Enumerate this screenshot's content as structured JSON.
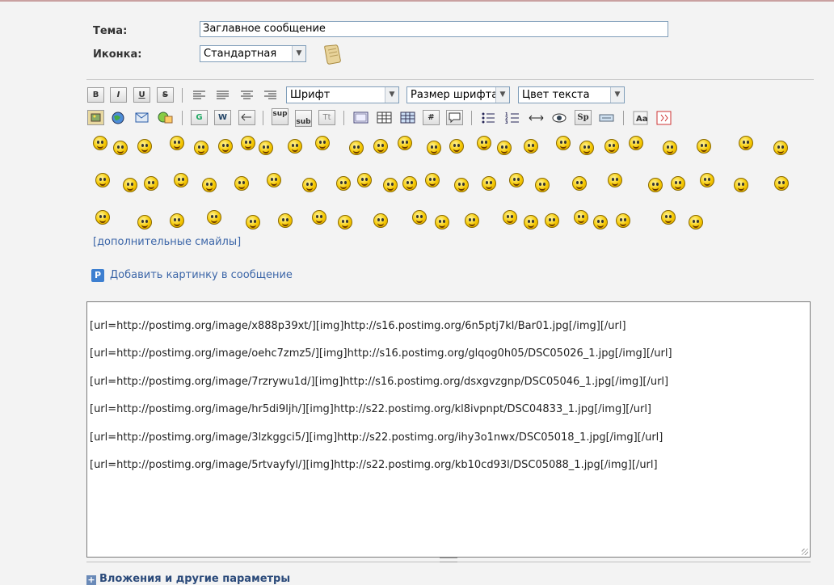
{
  "form": {
    "subject_label": "Тема:",
    "subject_value": "Заглавное сообщение",
    "icon_label": "Иконка:",
    "icon_value": "Стандартная"
  },
  "toolbar": {
    "row1": {
      "bold": "B",
      "italic": "I",
      "underline": "U",
      "strike": "S",
      "font_select": "Шрифт",
      "size_select": "Размер шрифта",
      "color_select": "Цвет текста"
    },
    "row2": {
      "google": "G",
      "wiki": "W",
      "sup": "sup",
      "sub": "sub",
      "tt": "Tt",
      "hash": "#",
      "spoiler": "Sp"
    }
  },
  "smilies": {
    "more_link": "[дополнительные смайлы]",
    "rows": [
      {
        "count": 30
      },
      {
        "count": 26
      },
      {
        "count": 26
      }
    ]
  },
  "add_picture_link": "Добавить картинку в сообщение",
  "message_lines": [
    "[url=http://postimg.org/image/x888p39xt/][img]http://s16.postimg.org/6n5ptj7kl/Bar01.jpg[/img][/url]",
    "[url=http://postimg.org/image/oehc7zmz5/][img]http://s16.postimg.org/glqog0h05/DSC05026_1.jpg[/img][/url]",
    "[url=http://postimg.org/image/7rzrywu1d/][img]http://s16.postimg.org/dsxgvzgnp/DSC05046_1.jpg[/img][/url]",
    "[url=http://postimg.org/image/hr5di9ljh/][img]http://s22.postimg.org/kl8ivpnpt/DSC04833_1.jpg[/img][/url]",
    "[url=http://postimg.org/image/3lzkggci5/][img]http://s22.postimg.org/ihy3o1nwx/DSC05018_1.jpg[/img][/url]",
    "[url=http://postimg.org/image/5rtvayfyl/][img]http://s22.postimg.org/kb10cd93l/DSC05088_1.jpg[/img][/url]"
  ],
  "attachments_label": "Вложения и другие параметры"
}
